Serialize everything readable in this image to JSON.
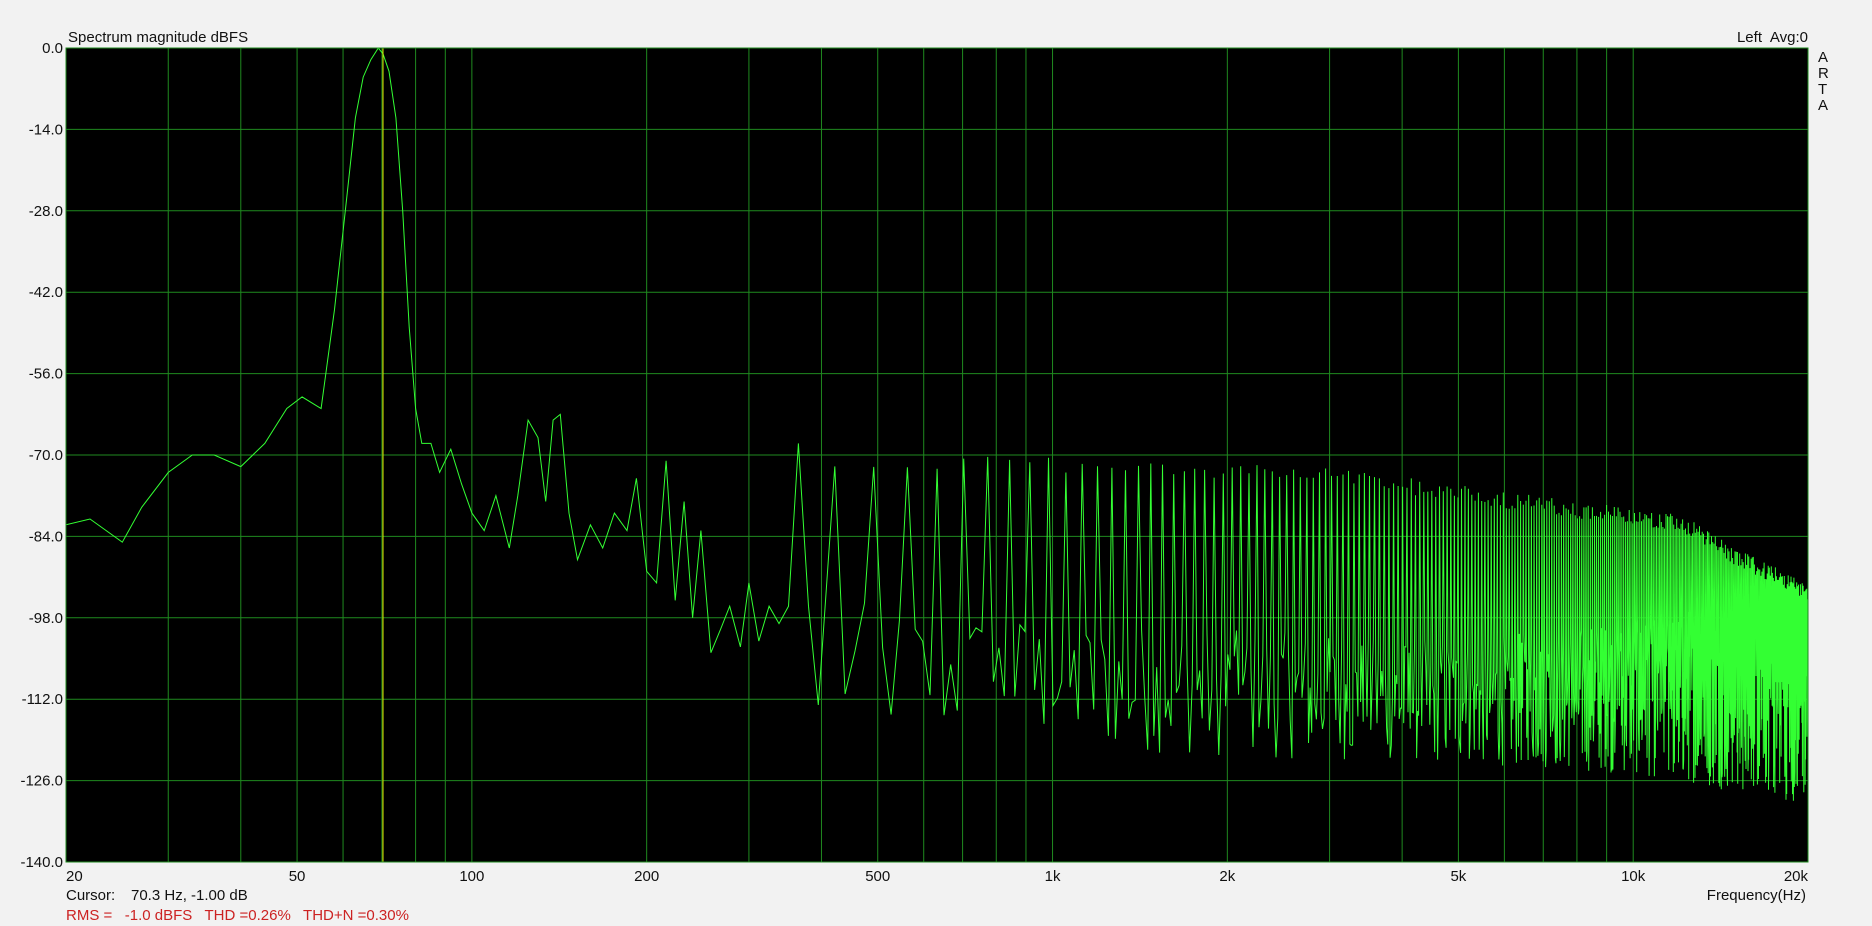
{
  "chart_data": {
    "type": "line",
    "title": "Spectrum magnitude dBFS",
    "channel_label": "Left",
    "avg_label": "Avg:0",
    "app_label": [
      "A",
      "R",
      "T",
      "A"
    ],
    "xlabel": "Frequency(Hz)",
    "ylabel": "",
    "x_scale": "log",
    "xlim": [
      20,
      20000
    ],
    "ylim": [
      -140,
      0
    ],
    "x_tick_values": [
      20,
      50,
      100,
      200,
      500,
      1000,
      2000,
      5000,
      10000,
      20000
    ],
    "x_tick_labels": [
      "20",
      "50",
      "100",
      "200",
      "500",
      "1k",
      "2k",
      "5k",
      "10k",
      "20k"
    ],
    "y_tick_values": [
      0,
      -14,
      -28,
      -42,
      -56,
      -70,
      -84,
      -98,
      -112,
      -126,
      -140
    ],
    "y_tick_labels": [
      "0.0",
      "-14.0",
      "-28.0",
      "-42.0",
      "-56.0",
      "-70.0",
      "-84.0",
      "-98.0",
      "-112.0",
      "-126.0",
      "-140.0"
    ],
    "grid": true,
    "colors": {
      "background": "#000000",
      "grid": "#1f8a1f",
      "trace": "#33ff33",
      "cursor": "#e6e600",
      "stats_text": "#cc2222"
    },
    "cursor": {
      "x": 70.3,
      "label_prefix": "Cursor:",
      "readout": "70.3 Hz, -1.00 dB"
    },
    "stats": {
      "text": "RMS =   -1.0 dBFS   THD =0.26%   THD+N =0.30%"
    },
    "fundamental_hz": 70.3,
    "series": [
      {
        "values_x": [
          20,
          22,
          25,
          27,
          30,
          33,
          36,
          40,
          44,
          48,
          51,
          55,
          58,
          61,
          63,
          65,
          67,
          69,
          70.3,
          72,
          74,
          76,
          78,
          80,
          82,
          85,
          88,
          92,
          96,
          100,
          105,
          110,
          116,
          120,
          125,
          130,
          134,
          138,
          142,
          147,
          152,
          160,
          168,
          176,
          185,
          192,
          200,
          208,
          216,
          224,
          232,
          240,
          248,
          258,
          268,
          278,
          290,
          300,
          312,
          325,
          338,
          351,
          365,
          380,
          395
        ],
        "values_y": [
          -82,
          -81,
          -85,
          -79,
          -73,
          -70,
          -70,
          -72,
          -68,
          -62,
          -60,
          -62,
          -45,
          -25,
          -12,
          -5,
          -2,
          0,
          -1,
          -4,
          -12,
          -28,
          -48,
          -62,
          -68,
          -68,
          -73,
          -69,
          -75,
          -80,
          -83,
          -77,
          -86,
          -77,
          -64,
          -67,
          -78,
          -64,
          -63,
          -80,
          -88,
          -82,
          -86,
          -80,
          -83,
          -74,
          -90,
          -92,
          -71,
          -95,
          -78,
          -98,
          -83,
          -104,
          -100,
          -96,
          -103,
          -92,
          -102,
          -96,
          -99,
          -96,
          -68,
          -96,
          -113
        ]
      }
    ],
    "harmonic_series": {
      "start_hz": 420,
      "end_hz": 20000,
      "peak_profile": [
        [
          420,
          -70
        ],
        [
          1000,
          -70
        ],
        [
          3000,
          -72
        ],
        [
          5000,
          -75
        ],
        [
          8000,
          -78
        ],
        [
          12000,
          -80
        ],
        [
          15000,
          -86
        ],
        [
          20000,
          -92
        ]
      ],
      "noise_upper_profile": [
        [
          420,
          -95
        ],
        [
          2000,
          -100
        ],
        [
          5000,
          -102
        ],
        [
          10000,
          -98
        ],
        [
          20000,
          -92
        ]
      ],
      "noise_lower_profile": [
        [
          420,
          -118
        ],
        [
          2000,
          -122
        ],
        [
          5000,
          -123
        ],
        [
          10000,
          -125
        ],
        [
          20000,
          -130
        ]
      ]
    }
  }
}
